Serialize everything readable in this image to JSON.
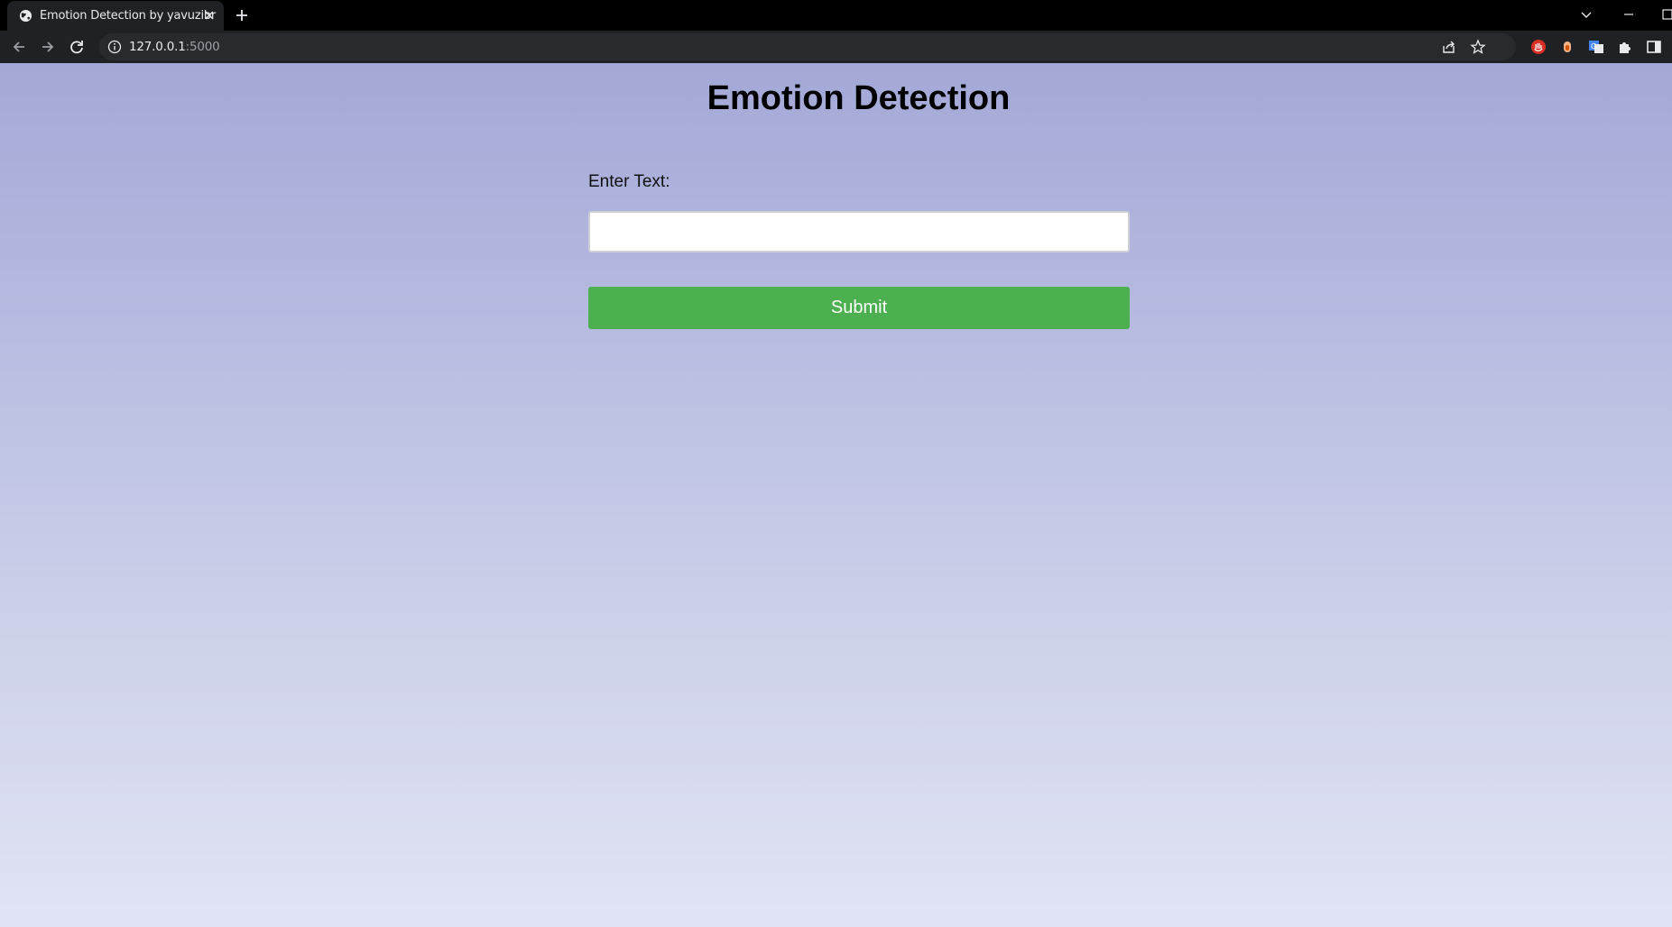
{
  "browser": {
    "tab": {
      "title": "Emotion Detection by yavuzibr",
      "favicon": "globe-icon"
    },
    "new_tab_icon": "plus-icon",
    "address_bar": {
      "host": "127.0.0.1",
      "port": ":5000",
      "info_icon": "info-icon"
    },
    "toolbar_icons": [
      "back-arrow-icon",
      "forward-arrow-icon",
      "reload-icon",
      "share-icon",
      "star-icon",
      "extension-red-icon",
      "extension-orange-icon",
      "translate-icon",
      "puzzle-icon",
      "side-panel-icon"
    ]
  },
  "page": {
    "title": "Emotion Detection",
    "form": {
      "label": "Enter Text:",
      "input_value": "",
      "input_placeholder": "",
      "submit_label": "Submit"
    }
  },
  "colors": {
    "gradient_top": "#a3a8d7",
    "gradient_bottom": "#e1e4f4",
    "submit_button": "#4caf50",
    "toolbar": "#202124",
    "tabstrip": "#000000"
  }
}
